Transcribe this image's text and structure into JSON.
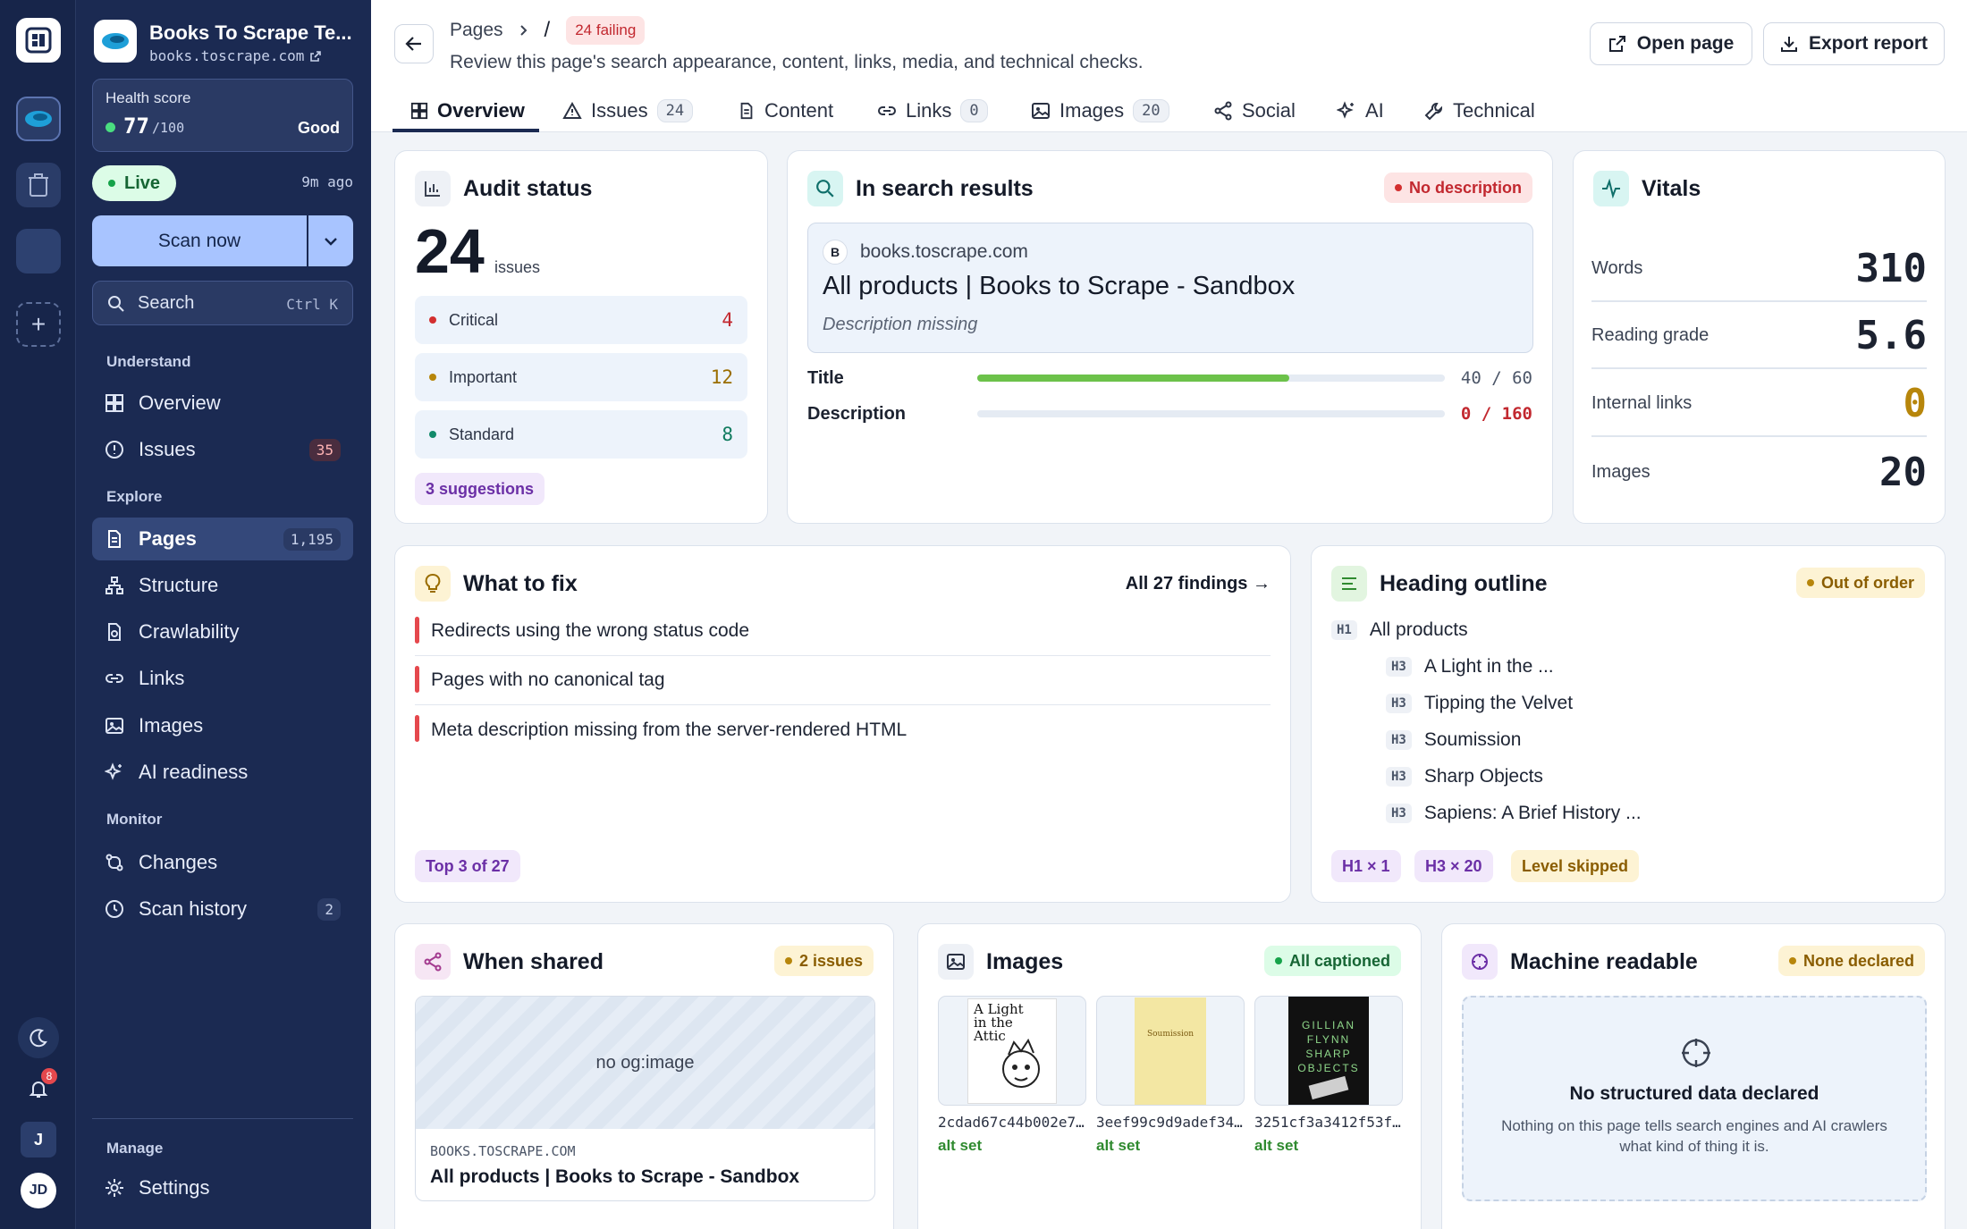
{
  "rail": {
    "notifications": "8",
    "user_initial": "J",
    "avatar": "JD"
  },
  "site": {
    "name": "Books To Scrape Te...",
    "domain": "books.toscrape.com"
  },
  "health": {
    "label": "Health score",
    "score": "77",
    "max": "/100",
    "status": "Good",
    "value": 77
  },
  "live": {
    "label": "Live",
    "ago": "9m ago"
  },
  "scan_label": "Scan now",
  "search": {
    "label": "Search",
    "shortcut": "Ctrl K"
  },
  "nav": {
    "understand": "Understand",
    "explore": "Explore",
    "monitor": "Monitor",
    "manage": "Manage",
    "overview": "Overview",
    "issues": "Issues",
    "issues_count": "35",
    "pages": "Pages",
    "pages_count": "1,195",
    "structure": "Structure",
    "crawlability": "Crawlability",
    "links": "Links",
    "images": "Images",
    "ai": "AI readiness",
    "changes": "Changes",
    "scan_history": "Scan history",
    "scan_history_count": "2",
    "settings": "Settings"
  },
  "header": {
    "breadcrumb": "Pages",
    "slash": "/",
    "failing": "24 failing",
    "subtitle": "Review this page's search appearance, content, links, media, and technical checks.",
    "open_page": "Open page",
    "export": "Export report"
  },
  "tabs": {
    "overview": "Overview",
    "issues": "Issues",
    "issues_count": "24",
    "content": "Content",
    "links": "Links",
    "links_count": "0",
    "images": "Images",
    "images_count": "20",
    "social": "Social",
    "ai": "AI",
    "technical": "Technical"
  },
  "audit": {
    "title": "Audit status",
    "count": "24",
    "count_label": "issues",
    "critical": "Critical",
    "critical_n": "4",
    "important": "Important",
    "important_n": "12",
    "standard": "Standard",
    "standard_n": "8",
    "suggestions": "3 suggestions"
  },
  "serp": {
    "title": "In search results",
    "badge": "No description",
    "favicon": "B",
    "domain": "books.toscrape.com",
    "page_title": "All products | Books to Scrape - Sandbox",
    "desc": "Description missing",
    "title_label": "Title",
    "title_len": "40 / 60",
    "title_fill": 0.667,
    "desc_label": "Description",
    "desc_len": "0 / 160",
    "desc_fill": 0
  },
  "vitals": {
    "title": "Vitals",
    "words_l": "Words",
    "words": "310",
    "grade_l": "Reading grade",
    "grade": "5.6",
    "links_l": "Internal links",
    "links": "0",
    "images_l": "Images",
    "images": "20"
  },
  "fix": {
    "title": "What to fix",
    "all": "All 27 findings →",
    "items": [
      "Redirects using the wrong status code",
      "Pages with no canonical tag",
      "Meta description missing from the server-rendered HTML"
    ],
    "chip": "Top 3 of 27"
  },
  "headings": {
    "title": "Heading outline",
    "badge": "Out of order",
    "h1": "H1",
    "h1_text": "All products",
    "h3": "H3",
    "items": [
      "A Light in the ...",
      "Tipping the Velvet",
      "Soumission",
      "Sharp Objects",
      "Sapiens: A Brief History ..."
    ],
    "chip_h1": "H1 × 1",
    "chip_h3": "H3 × 20",
    "chip_skip": "Level skipped"
  },
  "shared": {
    "title": "When shared",
    "badge": "2 issues",
    "no_image": "no og:image",
    "domain": "BOOKS.TOSCRAPE.COM",
    "page_title": "All products | Books to Scrape - Sandbox"
  },
  "images": {
    "title": "Images",
    "badge": "All captioned",
    "items": [
      {
        "file": "2cdad67c44b002e7...",
        "alt": "alt set",
        "cover_title": "A Light in the Attic"
      },
      {
        "file": "3eef99c9d9adef34...",
        "alt": "alt set",
        "cover_title": "Soumission"
      },
      {
        "file": "3251cf3a3412f53f...",
        "alt": "alt set",
        "cover_title": "GILLIAN FLYNN SHARP OBJECTS"
      }
    ]
  },
  "machine": {
    "title": "Machine readable",
    "badge": "None declared",
    "heading": "No structured data declared",
    "text1": "Nothing on this page tells search engines and AI crawlers",
    "text2": "what kind of thing it is."
  }
}
